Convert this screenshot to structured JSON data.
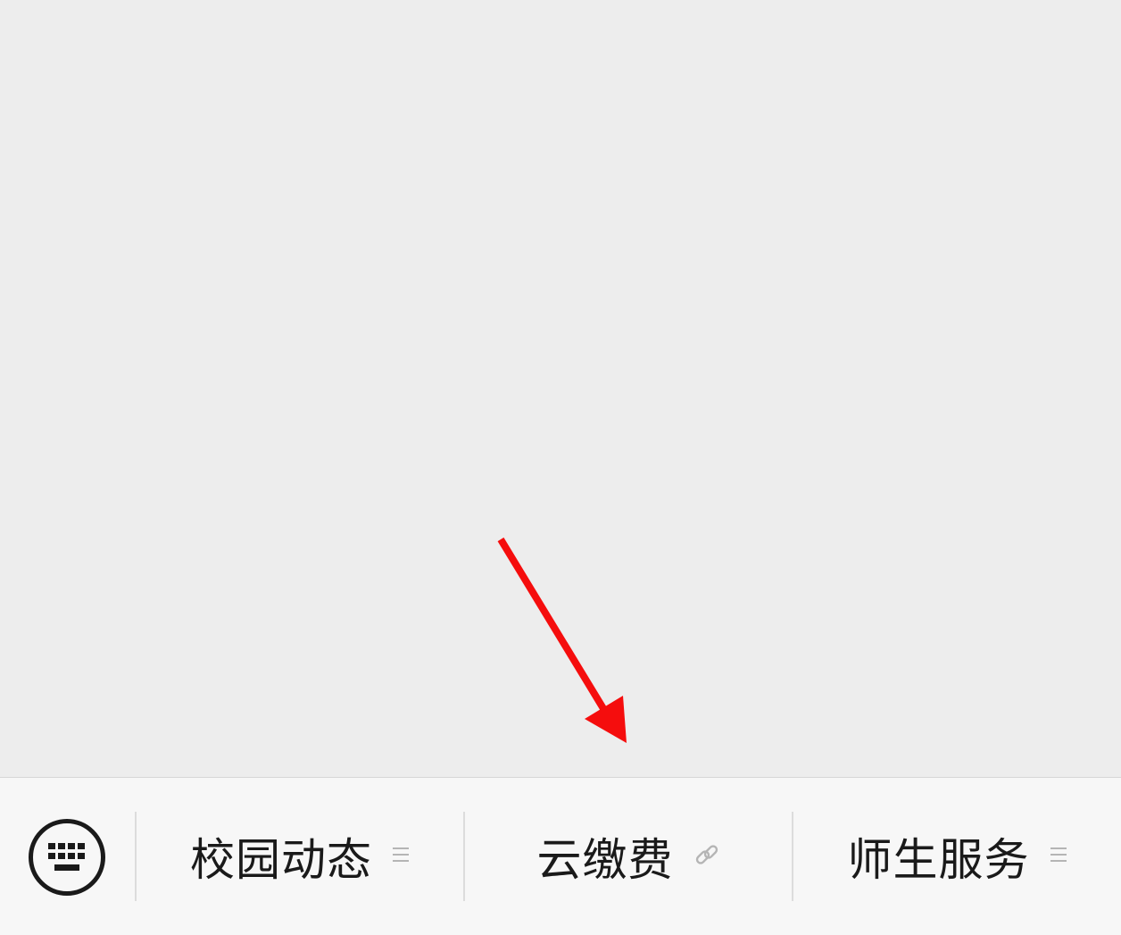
{
  "menu": {
    "items": [
      {
        "label": "校园动态",
        "icon": "list-icon"
      },
      {
        "label": "云缴费",
        "icon": "link-icon"
      },
      {
        "label": "师生服务",
        "icon": "list-icon"
      }
    ]
  },
  "annotation": {
    "color": "#f50d0d"
  },
  "colors": {
    "chat_background": "#ededed",
    "menu_background": "#f7f7f7",
    "text": "#1a1a1a",
    "icon_gray": "#b5b5b5"
  }
}
